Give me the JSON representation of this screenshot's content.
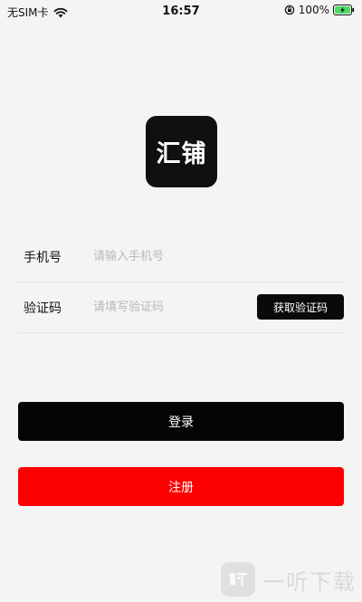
{
  "status_bar": {
    "carrier": "无SIM卡",
    "wifi_icon": "wifi-icon",
    "time": "16:57",
    "rotation_lock_icon": "rotation-lock-icon",
    "battery_percent": "100%",
    "battery_icon": "battery-charging-icon",
    "battery_color": "#4cd964"
  },
  "logo": {
    "text": "汇铺",
    "background_color": "#101010"
  },
  "form": {
    "phone": {
      "label": "手机号",
      "placeholder": "请输入手机号",
      "value": ""
    },
    "code": {
      "label": "验证码",
      "placeholder": "请填写验证码",
      "value": "",
      "button_label": "获取验证码"
    }
  },
  "actions": {
    "login_label": "登录",
    "login_color": "#050505",
    "register_label": "注册",
    "register_color": "#fc0000"
  },
  "watermark": {
    "icon": "listen-logo-icon",
    "text": "一听下载"
  }
}
